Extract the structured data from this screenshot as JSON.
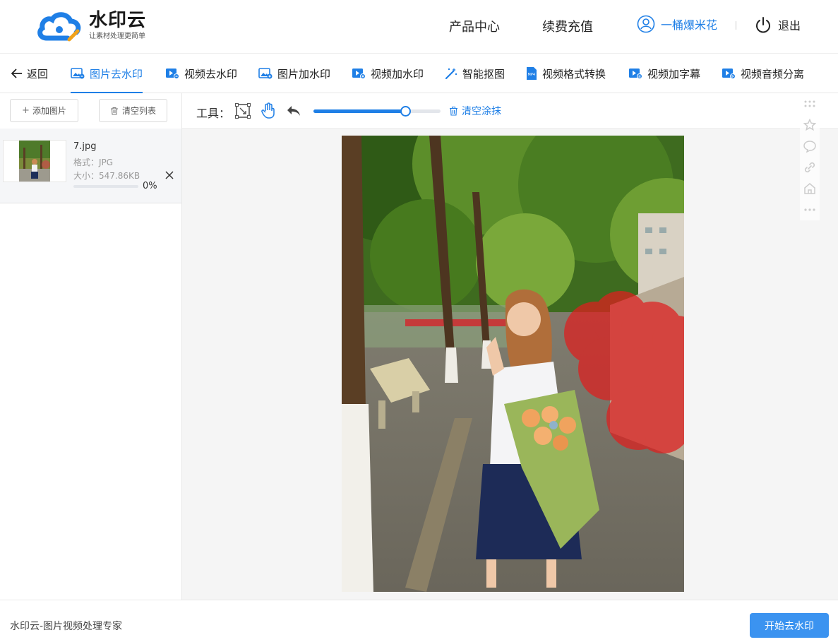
{
  "header": {
    "logo_name": "水印云",
    "logo_slogan": "让素材处理更简单",
    "nav_products": "产品中心",
    "nav_recharge": "续费充值",
    "username": "一桶爆米花",
    "logout": "退出"
  },
  "tabs": {
    "back": "返回",
    "items": [
      {
        "label": "图片去水印",
        "icon": "image-remove-icon"
      },
      {
        "label": "视频去水印",
        "icon": "video-remove-icon"
      },
      {
        "label": "图片加水印",
        "icon": "image-add-icon"
      },
      {
        "label": "视频加水印",
        "icon": "video-add-icon"
      },
      {
        "label": "智能抠图",
        "icon": "magic-wand-icon"
      },
      {
        "label": "视频格式转换",
        "icon": "mp4-file-icon"
      },
      {
        "label": "视频加字幕",
        "icon": "video-subtitle-icon"
      },
      {
        "label": "视频音频分离",
        "icon": "video-audio-icon"
      }
    ],
    "active_index": 0
  },
  "sidebar": {
    "add_image": "添加图片",
    "clear_list": "清空列表",
    "file": {
      "name": "7.jpg",
      "format": "格式：JPG",
      "size": "大小：547.86KB",
      "progress_pct": "0%",
      "progress": 0
    }
  },
  "toolbar": {
    "label": "工具：",
    "brush_level": 0.72,
    "clear_paint": "清空涂抹"
  },
  "footer": {
    "brand": "水印云-图片视频处理专家",
    "start_button": "开始去水印"
  },
  "colors": {
    "accent": "#1f7fe6",
    "button": "#3b93f0",
    "mask": "#e01e1e"
  }
}
